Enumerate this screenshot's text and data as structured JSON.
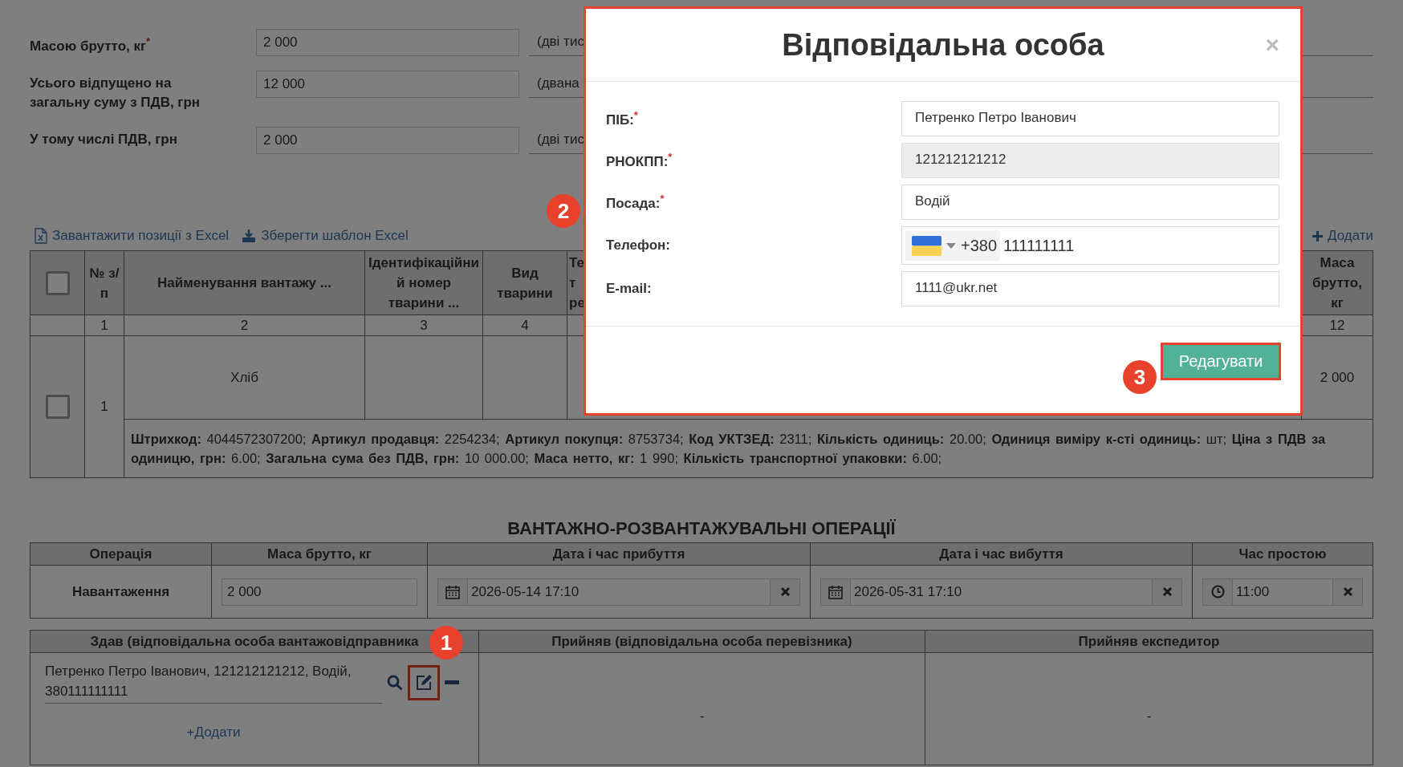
{
  "form_rows": [
    {
      "label": "Масою брутто, кг",
      "required_mark": "*",
      "value": "2 000",
      "words": "(дві тис"
    },
    {
      "label": "Усього відпущено на загальну суму з ПДВ, грн",
      "value": "12 000",
      "words": "(двана"
    },
    {
      "label": "У тому числі ПДВ, грн",
      "value": "2 000",
      "words": "(дві тис"
    }
  ],
  "links": {
    "upload": "Завантажити позиції з Excel",
    "template": "Зберегти шаблон Excel",
    "add": "Додати"
  },
  "goods_table": {
    "header_checked": false,
    "columns": [
      {
        "kind": "checkbox"
      },
      {
        "kind": "text",
        "label": "№ з/п",
        "number": "1"
      },
      {
        "kind": "text",
        "label": "Найменування вантажу ...",
        "number": "2"
      },
      {
        "kind": "text",
        "label": "Ідентифікаційний номер тварини ...",
        "number": "3"
      },
      {
        "kind": "text",
        "label": "Вид тварини",
        "number": "4"
      },
      {
        "kind": "cut",
        "label": "Те т ре"
      },
      {
        "kind": "text",
        "label": "Маса брутто, кг",
        "number": "12"
      }
    ],
    "rows": [
      {
        "checked": false,
        "number": "1",
        "name": "Хліб",
        "mass": "2 000",
        "details": "**Штрихкод:** 4044572307200; **Артикул продавця:** 2254234; **Артикул покупця:** 8753734; **Код УКТЗЕД:** 2311; **Кількість одиниць:** 20.00; **Одиниця виміру к-сті одиниць:** шт; **Ціна з ПДВ за одиницю, грн:** 6.00; **Загальна сума без ПДВ, грн:** 10 000.00; **Маса нетто, кг:** 1 990; **Кількість транспортної упаковки:** 6.00;"
      }
    ]
  },
  "operations": {
    "title": "ВАНТАЖНО-РОЗВАНТАЖУВАЛЬНІ ОПЕРАЦІЇ",
    "columns": [
      "Операція",
      "Маса брутто, кг",
      "Дата і час прибуття",
      "Дата і час вибуття",
      "Час простою"
    ],
    "row": {
      "operation": "Навантаження",
      "mass": "2 000",
      "arrival": "2026-05-14 17:10",
      "departure": "2026-05-31 17:10",
      "idle": "11:00"
    }
  },
  "persons": {
    "columns": [
      "Здав (відповідальна особа вантажовідправника",
      "Прийняв (відповідальна особа перевізника)",
      "Прийняв експедитор"
    ],
    "shipper": {
      "text": "Петренко Петро Іванович, 121212121212, Водій, 380111111111",
      "edit_highlighted": true,
      "add": "+Додати"
    },
    "carrier": "-",
    "forwarder": "-"
  },
  "modal": {
    "title": "Відповідальна особа",
    "close": "×",
    "fields": [
      {
        "kind": "text",
        "label": "ПІБ:",
        "required_mark": "*",
        "value": "Петренко Петро Іванович",
        "readonly": false
      },
      {
        "kind": "text",
        "label": "РНОКПП:",
        "required_mark": "*",
        "value": "121212121212",
        "readonly": true
      },
      {
        "kind": "text",
        "label": "Посада:",
        "required_mark": "*",
        "value": "Водій",
        "readonly": false
      },
      {
        "kind": "phone",
        "label": "Телефон:",
        "code": "+380",
        "value": "111111111",
        "readonly": false
      },
      {
        "kind": "text",
        "label": "E-mail:",
        "value": "1111@ukr.net",
        "readonly": false
      }
    ],
    "button": "Редагувати",
    "button_highlighted": true
  },
  "markers": [
    "1",
    "2",
    "3"
  ]
}
